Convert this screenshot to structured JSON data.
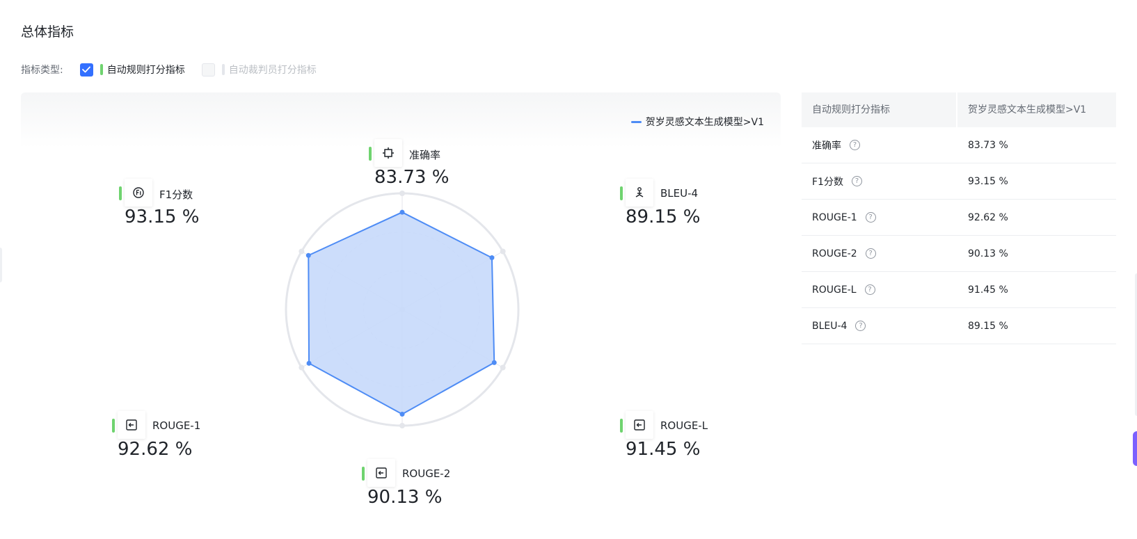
{
  "page": {
    "title": "总体指标"
  },
  "filters": {
    "label": "指标类型:",
    "options": [
      {
        "label": "自动规则打分指标",
        "checked": true,
        "bar_color": "#6fd36f"
      },
      {
        "label": "自动裁判员打分指标",
        "checked": false,
        "bar_color": "#e4e6eb"
      }
    ]
  },
  "colors": {
    "accent": "#3370ff",
    "series": "#4e8cf5",
    "series_fill": "#c6d9fb",
    "metric_bar": "#6fd36f"
  },
  "chart_data": {
    "type": "radar",
    "title": "",
    "unit": "%",
    "range": [
      0,
      100
    ],
    "legend_position": "top-right",
    "categories": [
      "准确率",
      "BLEU-4",
      "ROUGE-L",
      "ROUGE-2",
      "ROUGE-1",
      "F1分数"
    ],
    "category_icons": [
      "target-icon",
      "bleu-icon",
      "rouge-icon",
      "rouge-icon",
      "rouge-icon",
      "f1-icon"
    ],
    "value_labels": [
      "83.73 %",
      "89.15 %",
      "91.45 %",
      "90.13 %",
      "92.62 %",
      "93.15 %"
    ],
    "series": [
      {
        "name": "贺岁灵感文本生成模型>V1",
        "values": [
          83.73,
          89.15,
          91.45,
          90.13,
          92.62,
          93.15
        ]
      }
    ]
  },
  "table": {
    "headers": [
      "自动规则打分指标",
      "贺岁灵感文本生成模型>V1"
    ],
    "rows": [
      {
        "metric": "准确率",
        "value": "83.73 %"
      },
      {
        "metric": "F1分数",
        "value": "93.15 %"
      },
      {
        "metric": "ROUGE-1",
        "value": "92.62 %"
      },
      {
        "metric": "ROUGE-2",
        "value": "90.13 %"
      },
      {
        "metric": "ROUGE-L",
        "value": "91.45 %"
      },
      {
        "metric": "BLEU-4",
        "value": "89.15 %"
      }
    ],
    "help_glyph": "?"
  }
}
